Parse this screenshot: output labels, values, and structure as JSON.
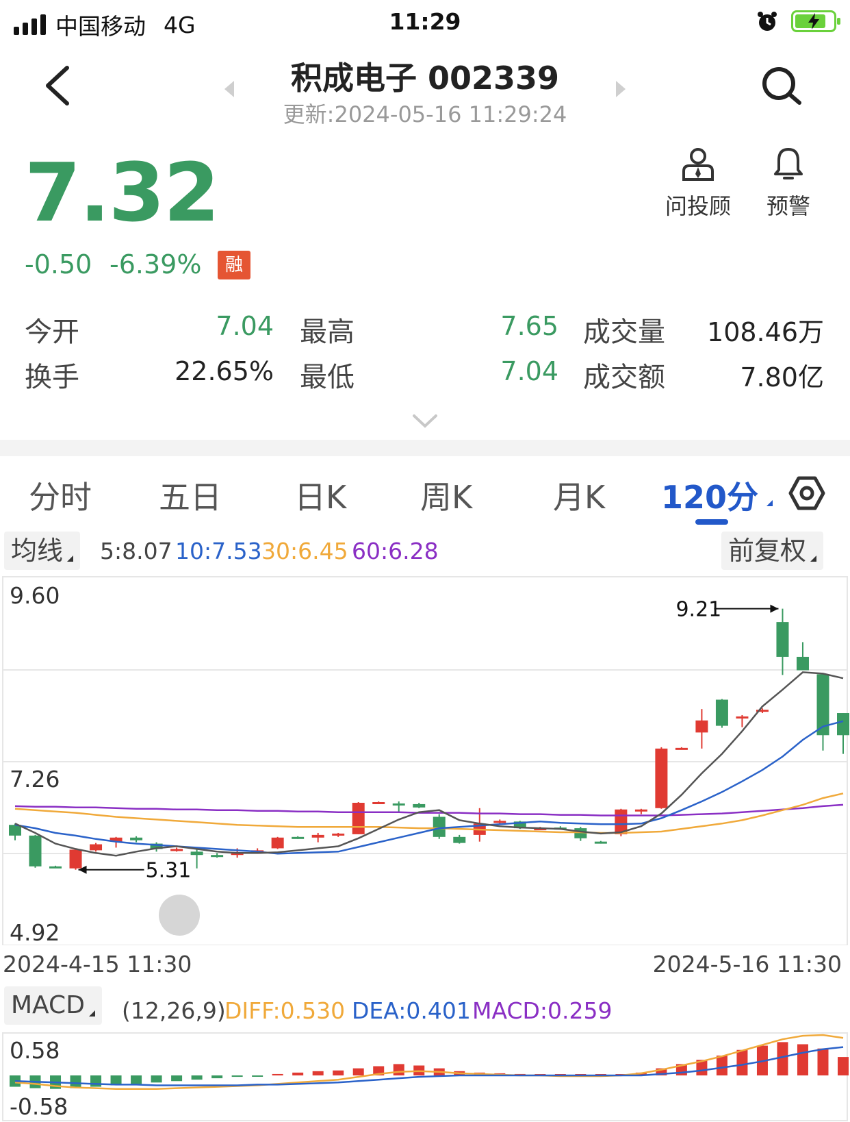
{
  "status_bar": {
    "carrier": "中国移动",
    "network": "4G",
    "time": "11:29"
  },
  "header": {
    "title": "积成电子 002339",
    "updated": "更新:2024-05-16 11:29:24",
    "icons": [
      "back-arrow-icon",
      "left-triangle-icon",
      "right-triangle-icon",
      "search-icon"
    ]
  },
  "quote": {
    "price": "7.32",
    "change": "-0.50",
    "change_pct": "-6.39%",
    "margin_badge": "融",
    "color_down": "#3a9a61"
  },
  "tools": [
    {
      "label": "问投顾",
      "icon": "advisor-icon"
    },
    {
      "label": "预警",
      "icon": "bell-icon"
    }
  ],
  "stats": {
    "open_label": "今开",
    "open": "7.04",
    "high_label": "最高",
    "high": "7.65",
    "volume_label": "成交量",
    "volume": "108.46万",
    "turnover_label": "换手",
    "turnover": "22.65%",
    "low_label": "最低",
    "low": "7.04",
    "amount_label": "成交额",
    "amount": "7.80亿"
  },
  "tabs": [
    "分时",
    "五日",
    "日K",
    "周K",
    "月K",
    "120分"
  ],
  "active_tab": "120分",
  "ma_bar": {
    "button": "均线",
    "ma5": "5:8.07",
    "ma10": "10:7.53",
    "ma30": "30:6.45",
    "ma60": "60:6.28",
    "adjust": "前复权",
    "colors": {
      "ma5": "#555555",
      "ma10": "#2a62c9",
      "ma30": "#f0a93a",
      "ma60": "#8a2fc4"
    }
  },
  "chart_data": {
    "type": "candlestick",
    "y_axis_labels": [
      "9.60",
      "7.26",
      "4.92"
    ],
    "ylim": [
      4.92,
      9.6
    ],
    "x_start": "2024-4-15 11:30",
    "x_end": "2024-5-16 11:30",
    "annotations": [
      {
        "label": "9.21",
        "value": 9.21,
        "candle": 38
      },
      {
        "label": "5.31",
        "value": 5.31,
        "candle": 3
      }
    ],
    "candles": [
      [
        5.98,
        5.82,
        6.0,
        5.75
      ],
      [
        5.82,
        5.36,
        5.83,
        5.34
      ],
      [
        5.36,
        5.35,
        5.37,
        5.35
      ],
      [
        5.33,
        5.61,
        5.63,
        5.31
      ],
      [
        5.6,
        5.69,
        5.71,
        5.58
      ],
      [
        5.73,
        5.79,
        5.8,
        5.64
      ],
      [
        5.79,
        5.75,
        5.81,
        5.72
      ],
      [
        5.7,
        5.62,
        5.72,
        5.58
      ],
      [
        5.6,
        5.62,
        5.64,
        5.58
      ],
      [
        5.58,
        5.53,
        5.61,
        5.33
      ],
      [
        5.53,
        5.51,
        5.56,
        5.49
      ],
      [
        5.53,
        5.57,
        5.63,
        5.49
      ],
      [
        5.58,
        5.6,
        5.63,
        5.56
      ],
      [
        5.63,
        5.79,
        5.8,
        5.62
      ],
      [
        5.8,
        5.78,
        5.81,
        5.77
      ],
      [
        5.79,
        5.83,
        5.86,
        5.72
      ],
      [
        5.82,
        5.85,
        5.86,
        5.8
      ],
      [
        5.84,
        6.31,
        6.32,
        5.84
      ],
      [
        6.31,
        6.32,
        6.33,
        6.3
      ],
      [
        6.3,
        6.28,
        6.33,
        6.16
      ],
      [
        6.29,
        6.24,
        6.31,
        6.23
      ],
      [
        6.1,
        5.8,
        6.14,
        5.77
      ],
      [
        5.8,
        5.71,
        5.83,
        5.7
      ],
      [
        5.83,
        6.0,
        6.23,
        5.73
      ],
      [
        6.01,
        6.04,
        6.06,
        5.99
      ],
      [
        6.03,
        5.93,
        6.04,
        5.92
      ],
      [
        5.93,
        5.93,
        5.95,
        5.92
      ],
      [
        5.94,
        5.93,
        5.96,
        5.91
      ],
      [
        5.93,
        5.78,
        5.95,
        5.74
      ],
      [
        5.73,
        5.72,
        5.74,
        5.7
      ],
      [
        5.84,
        6.21,
        6.22,
        5.81
      ],
      [
        6.2,
        6.21,
        6.22,
        6.14
      ],
      [
        6.23,
        7.12,
        7.14,
        6.22
      ],
      [
        7.12,
        7.13,
        7.14,
        7.11
      ],
      [
        7.36,
        7.54,
        7.71,
        7.12
      ],
      [
        7.85,
        7.46,
        7.86,
        7.43
      ],
      [
        7.6,
        7.6,
        7.62,
        7.44
      ],
      [
        7.7,
        7.7,
        7.72,
        7.65
      ],
      [
        9.01,
        8.49,
        9.21,
        8.22
      ],
      [
        8.49,
        8.29,
        8.71,
        8.31
      ],
      [
        8.23,
        7.32,
        8.03,
        7.09
      ],
      [
        7.65,
        7.32,
        7.65,
        7.04
      ]
    ],
    "ma_lines": {
      "ma5": [
        6.0,
        5.86,
        5.7,
        5.62,
        5.56,
        5.52,
        5.58,
        5.63,
        5.66,
        5.62,
        5.58,
        5.56,
        5.56,
        5.57,
        5.6,
        5.63,
        5.66,
        5.78,
        5.92,
        6.06,
        6.17,
        6.2,
        6.05,
        6.0,
        5.96,
        5.94,
        5.93,
        5.92,
        5.88,
        5.85,
        5.87,
        5.96,
        6.15,
        6.43,
        6.75,
        7.04,
        7.38,
        7.75,
        8.0,
        8.26,
        8.24,
        8.17
      ],
      "ma10": [
        5.98,
        5.93,
        5.86,
        5.82,
        5.77,
        5.73,
        5.7,
        5.68,
        5.66,
        5.64,
        5.62,
        5.6,
        5.58,
        5.55,
        5.56,
        5.57,
        5.58,
        5.65,
        5.72,
        5.79,
        5.86,
        5.93,
        5.95,
        5.97,
        5.99,
        6.01,
        6.03,
        6.01,
        6.0,
        5.99,
        5.99,
        6.0,
        6.08,
        6.2,
        6.33,
        6.47,
        6.63,
        6.8,
        7.0,
        7.25,
        7.45,
        7.53
      ],
      "ma30": [
        6.22,
        6.2,
        6.18,
        6.16,
        6.13,
        6.1,
        6.08,
        6.06,
        6.04,
        6.02,
        6.0,
        5.98,
        5.97,
        5.96,
        5.95,
        5.95,
        5.95,
        5.95,
        5.95,
        5.94,
        5.93,
        5.93,
        5.92,
        5.91,
        5.9,
        5.89,
        5.88,
        5.87,
        5.87,
        5.86,
        5.86,
        5.87,
        5.88,
        5.92,
        5.96,
        6.0,
        6.05,
        6.12,
        6.2,
        6.28,
        6.38,
        6.45
      ],
      "ma60": [
        6.26,
        6.25,
        6.25,
        6.24,
        6.24,
        6.23,
        6.22,
        6.22,
        6.21,
        6.21,
        6.2,
        6.2,
        6.19,
        6.19,
        6.18,
        6.18,
        6.17,
        6.17,
        6.17,
        6.17,
        6.16,
        6.16,
        6.16,
        6.15,
        6.15,
        6.14,
        6.14,
        6.13,
        6.13,
        6.12,
        6.12,
        6.12,
        6.12,
        6.13,
        6.14,
        6.15,
        6.17,
        6.19,
        6.21,
        6.23,
        6.26,
        6.28
      ]
    }
  },
  "macd": {
    "button": "MACD",
    "params": "(12,26,9)",
    "diff": "DIFF:0.530",
    "dea": "DEA:0.401",
    "macd": "MACD:0.259",
    "y_labels": [
      "0.58",
      "-0.58"
    ],
    "colors": {
      "diff": "#f0a93a",
      "dea": "#2a62c9",
      "macd": "#8a2fc4"
    },
    "chart_data": {
      "type": "bar",
      "ylim": [
        -0.58,
        0.58
      ],
      "hist": [
        -0.16,
        -0.18,
        -0.19,
        -0.18,
        -0.16,
        -0.14,
        -0.12,
        -0.1,
        -0.08,
        -0.06,
        -0.04,
        -0.02,
        -0.01,
        0.02,
        0.04,
        0.06,
        0.07,
        0.1,
        0.13,
        0.16,
        0.14,
        0.1,
        0.06,
        0.04,
        0.03,
        0.02,
        0.01,
        0.0,
        0.0,
        0.0,
        0.01,
        0.04,
        0.1,
        0.16,
        0.22,
        0.28,
        0.36,
        0.42,
        0.47,
        0.44,
        0.38,
        0.26
      ],
      "diff": [
        -0.1,
        -0.12,
        -0.15,
        -0.17,
        -0.18,
        -0.19,
        -0.19,
        -0.19,
        -0.18,
        -0.17,
        -0.16,
        -0.15,
        -0.14,
        -0.12,
        -0.1,
        -0.08,
        -0.06,
        -0.02,
        0.02,
        0.05,
        0.06,
        0.05,
        0.03,
        0.02,
        0.01,
        0.0,
        0.0,
        -0.01,
        -0.01,
        -0.01,
        0.0,
        0.03,
        0.08,
        0.14,
        0.2,
        0.27,
        0.35,
        0.43,
        0.51,
        0.56,
        0.57,
        0.53
      ],
      "dea": [
        -0.08,
        -0.09,
        -0.1,
        -0.11,
        -0.12,
        -0.13,
        -0.13,
        -0.14,
        -0.14,
        -0.14,
        -0.14,
        -0.14,
        -0.13,
        -0.13,
        -0.12,
        -0.11,
        -0.1,
        -0.08,
        -0.06,
        -0.04,
        -0.02,
        -0.01,
        0.0,
        0.0,
        0.0,
        0.0,
        0.0,
        0.0,
        0.0,
        0.0,
        0.0,
        0.0,
        0.02,
        0.04,
        0.07,
        0.11,
        0.15,
        0.2,
        0.26,
        0.32,
        0.37,
        0.4
      ]
    }
  }
}
